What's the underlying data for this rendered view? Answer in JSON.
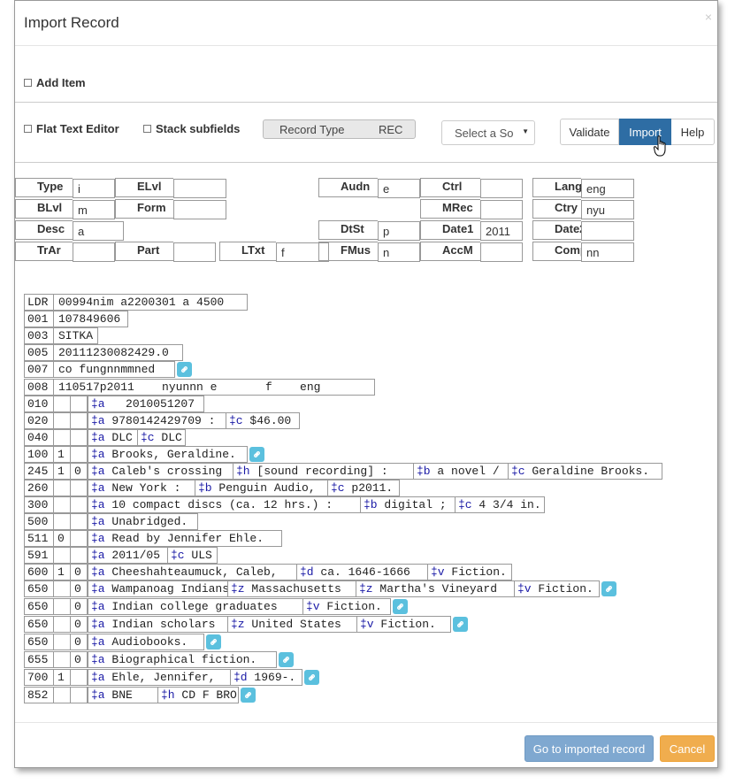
{
  "dialog": {
    "title": "Import Record",
    "close": "×"
  },
  "options": {
    "add_item": "Add Item",
    "flat_text": "Flat Text Editor",
    "stack": "Stack subfields"
  },
  "record_type": {
    "label": "Record Type",
    "value": "REC"
  },
  "source_select": {
    "value": "Select a So"
  },
  "buttons": {
    "validate": "Validate",
    "import": "Import",
    "help": "Help",
    "goto": "Go to imported record",
    "cancel": "Cancel"
  },
  "fixed_fields": [
    {
      "label": "Type",
      "value": "i"
    },
    {
      "label": "ELvl",
      "value": ""
    },
    {
      "label": "Audn",
      "value": "e"
    },
    {
      "label": "Ctrl",
      "value": ""
    },
    {
      "label": "Lang",
      "value": "eng"
    },
    {
      "label": "BLvl",
      "value": "m"
    },
    {
      "label": "Form",
      "value": ""
    },
    {
      "label": "MRec",
      "value": ""
    },
    {
      "label": "Ctry",
      "value": "nyu"
    },
    {
      "label": "Desc",
      "value": "a"
    },
    {
      "label": "DtSt",
      "value": "p"
    },
    {
      "label": "Date1",
      "value": "2011"
    },
    {
      "label": "Date2",
      "value": ""
    },
    {
      "label": "TrAr",
      "value": ""
    },
    {
      "label": "Part",
      "value": ""
    },
    {
      "label": "LTxt",
      "value": "f"
    },
    {
      "label": "FMus",
      "value": "n"
    },
    {
      "label": "AccM",
      "value": ""
    },
    {
      "label": "Comp",
      "value": "nn"
    }
  ],
  "marc": [
    {
      "tag": "LDR",
      "text": "00994nim a2200301 a 4500"
    },
    {
      "tag": "001",
      "text": "107849606"
    },
    {
      "tag": "003",
      "text": "SITKA"
    },
    {
      "tag": "005",
      "text": "20111230082429.0"
    },
    {
      "tag": "007",
      "text": "co fungnnmmned"
    },
    {
      "tag": "008",
      "text": "110517p2011    nyunnn e       f    eng  "
    },
    {
      "tag": "010",
      "i1": "",
      "i2": "",
      "sub": [
        {
          "c": "‡a",
          "v": "  2010051207"
        }
      ]
    },
    {
      "tag": "020",
      "i1": "",
      "i2": "",
      "sub": [
        {
          "c": "‡a",
          "v": "9780142429709 :"
        },
        {
          "c": "‡c",
          "v": "$46.00"
        }
      ]
    },
    {
      "tag": "040",
      "i1": "",
      "i2": "",
      "sub": [
        {
          "c": "‡a",
          "v": "DLC"
        },
        {
          "c": "‡c",
          "v": "DLC"
        }
      ]
    },
    {
      "tag": "100",
      "i1": "1",
      "i2": "",
      "sub": [
        {
          "c": "‡a",
          "v": "Brooks, Geraldine."
        }
      ]
    },
    {
      "tag": "245",
      "i1": "1",
      "i2": "0",
      "sub": [
        {
          "c": "‡a",
          "v": "Caleb's crossing"
        },
        {
          "c": "‡h",
          "v": "[sound recording] :"
        },
        {
          "c": "‡b",
          "v": "a novel /"
        },
        {
          "c": "‡c",
          "v": "Geraldine Brooks."
        }
      ]
    },
    {
      "tag": "260",
      "i1": "",
      "i2": "",
      "sub": [
        {
          "c": "‡a",
          "v": "New York :"
        },
        {
          "c": "‡b",
          "v": "Penguin Audio,"
        },
        {
          "c": "‡c",
          "v": "p2011."
        }
      ]
    },
    {
      "tag": "300",
      "i1": "",
      "i2": "",
      "sub": [
        {
          "c": "‡a",
          "v": "10 compact discs (ca. 12 hrs.) :"
        },
        {
          "c": "‡b",
          "v": "digital ;"
        },
        {
          "c": "‡c",
          "v": "4 3/4 in."
        }
      ]
    },
    {
      "tag": "500",
      "i1": "",
      "i2": "",
      "sub": [
        {
          "c": "‡a",
          "v": "Unabridged."
        }
      ]
    },
    {
      "tag": "511",
      "i1": "0",
      "i2": "",
      "sub": [
        {
          "c": "‡a",
          "v": "Read by Jennifer Ehle."
        }
      ]
    },
    {
      "tag": "591",
      "i1": "",
      "i2": "",
      "sub": [
        {
          "c": "‡a",
          "v": "2011/05"
        },
        {
          "c": "‡c",
          "v": "ULS"
        }
      ]
    },
    {
      "tag": "600",
      "i1": "1",
      "i2": "0",
      "sub": [
        {
          "c": "‡a",
          "v": "Cheeshahteaumuck, Caleb,"
        },
        {
          "c": "‡d",
          "v": "ca. 1646-1666"
        },
        {
          "c": "‡v",
          "v": "Fiction."
        }
      ]
    },
    {
      "tag": "650",
      "i1": "",
      "i2": "0",
      "sub": [
        {
          "c": "‡a",
          "v": "Wampanoag Indians"
        },
        {
          "c": "‡z",
          "v": "Massachusetts"
        },
        {
          "c": "‡z",
          "v": "Martha's Vineyard"
        },
        {
          "c": "‡v",
          "v": "Fiction."
        }
      ]
    },
    {
      "tag": "650",
      "i1": "",
      "i2": "0",
      "sub": [
        {
          "c": "‡a",
          "v": "Indian college graduates"
        },
        {
          "c": "‡v",
          "v": "Fiction."
        }
      ]
    },
    {
      "tag": "650",
      "i1": "",
      "i2": "0",
      "sub": [
        {
          "c": "‡a",
          "v": "Indian scholars"
        },
        {
          "c": "‡z",
          "v": "United States"
        },
        {
          "c": "‡v",
          "v": "Fiction."
        }
      ]
    },
    {
      "tag": "650",
      "i1": "",
      "i2": "0",
      "sub": [
        {
          "c": "‡a",
          "v": "Audiobooks."
        }
      ]
    },
    {
      "tag": "655",
      "i1": "",
      "i2": "0",
      "sub": [
        {
          "c": "‡a",
          "v": "Biographical fiction."
        }
      ]
    },
    {
      "tag": "700",
      "i1": "1",
      "i2": "",
      "sub": [
        {
          "c": "‡a",
          "v": "Ehle, Jennifer,"
        },
        {
          "c": "‡d",
          "v": "1969-."
        }
      ]
    },
    {
      "tag": "852",
      "i1": "",
      "i2": "",
      "sub": [
        {
          "c": "‡a",
          "v": "BNE"
        },
        {
          "c": "‡h",
          "v": "CD F BRO"
        }
      ]
    }
  ]
}
